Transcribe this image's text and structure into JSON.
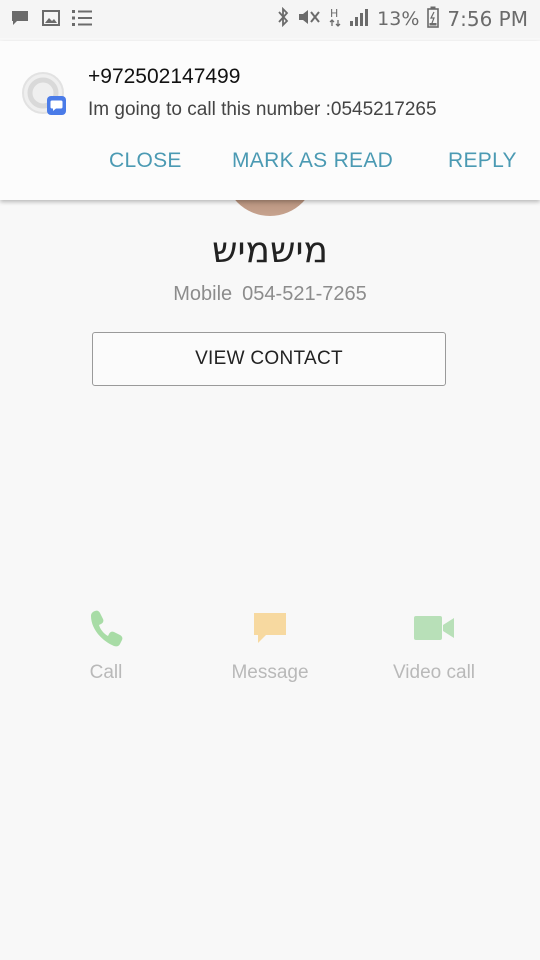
{
  "status_bar": {
    "battery_percent": "13%",
    "time": "7:56 PM",
    "left_icons": [
      "chat-bubble-icon",
      "image-icon",
      "list-icon"
    ],
    "right_icons": [
      "bluetooth-icon",
      "mute-icon",
      "network-h-icon",
      "signal-icon",
      "battery-icon"
    ]
  },
  "notification": {
    "title": "+972502147499",
    "body": "Im going to call this number :0545217265",
    "actions": {
      "close": "CLOSE",
      "mark_as_read": "MARK AS READ",
      "reply": "REPLY"
    },
    "app_badge_color": "#4a7be8"
  },
  "contact": {
    "name": "מישמיש",
    "phone_type": "Mobile",
    "phone_number": "054-521-7265",
    "view_contact_label": "VIEW CONTACT"
  },
  "actions": {
    "call": {
      "label": "Call",
      "icon": "phone-icon",
      "color": "#a8dca6"
    },
    "message": {
      "label": "Message",
      "icon": "message-icon",
      "color": "#f7d9a0"
    },
    "video_call": {
      "label": "Video call",
      "icon": "video-camera-icon",
      "color": "#b8e0b8"
    }
  },
  "colors": {
    "accent": "#4b9ab3",
    "background": "#f8f8f8"
  }
}
